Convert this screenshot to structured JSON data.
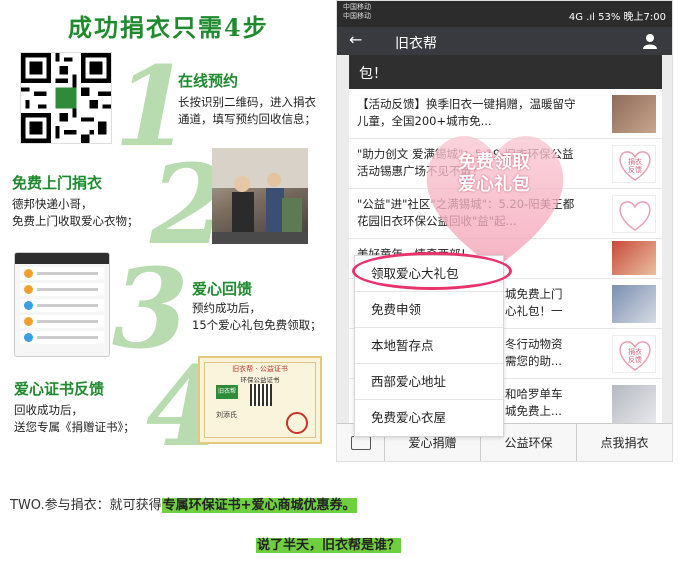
{
  "poster": {
    "title": "成功捐衣只需4步",
    "steps": [
      {
        "num": "1",
        "title": "在线预约",
        "desc": [
          "长按识别二维码，进入捐衣",
          "通道，填写预约回收信息；"
        ]
      },
      {
        "num": "2",
        "title": "免费上门捐衣",
        "desc": [
          "德邦快递小哥，",
          "免费上门收取爱心衣物；"
        ]
      },
      {
        "num": "3",
        "title": "爱心回馈",
        "desc": [
          "预约成功后，",
          "15个爱心礼包免费领取；"
        ]
      },
      {
        "num": "4",
        "title": "爱心证书反馈",
        "desc": [
          "回收成功后，",
          "送您专属《捐赠证书》；"
        ]
      }
    ],
    "certificate": {
      "head": "旧衣帮 · 公益证书",
      "sub": "环保公益证书",
      "logo": "旧衣帮",
      "name": "刘添氏"
    }
  },
  "phone": {
    "status_carrier": [
      "中国移动",
      "中国移动"
    ],
    "status_right": "4G .ıl 53% 晚上7:00",
    "app_title": "旧衣帮",
    "header_text": "包！",
    "feed_items": [
      {
        "text": "【活动反馈】换季旧衣一键捐赠，温暖留守儿童，全国200+城市免..."
      },
      {
        "text": "\"助力创文 爱满锡城\"：5.19-旧衣环保公益活动锡惠广场不见不散！"
      },
      {
        "text": "\"公益\"进\"社区\"之满锡城\"：5.20-阳美王都花园旧衣环保公益回收\"益\"起..."
      },
      {
        "text": "美好童年，情牵西部！"
      }
    ],
    "heart_text": [
      "免费领取",
      "爱心礼包"
    ],
    "thumb_labels": [
      "捐衣",
      "反馈"
    ],
    "menu": [
      "领取爱心大礼包",
      "免费申领",
      "本地暂存点",
      "西部爱心地址",
      "免费爱心衣屋"
    ],
    "behind_fragments": [
      "城免费上门",
      "心礼包！一",
      "冬行动物资",
      "需您的助...",
      "和哈罗单车",
      "城免费上..."
    ],
    "tabs": [
      "爱心捐赠",
      "公益环保",
      "点我捐衣"
    ]
  },
  "footer": {
    "line1_prefix": "TWO.参与捐衣：就可获得",
    "line1_highlight": "专属环保证书+爱心商城优惠券。",
    "line2": "说了半天，旧衣帮是谁？"
  }
}
